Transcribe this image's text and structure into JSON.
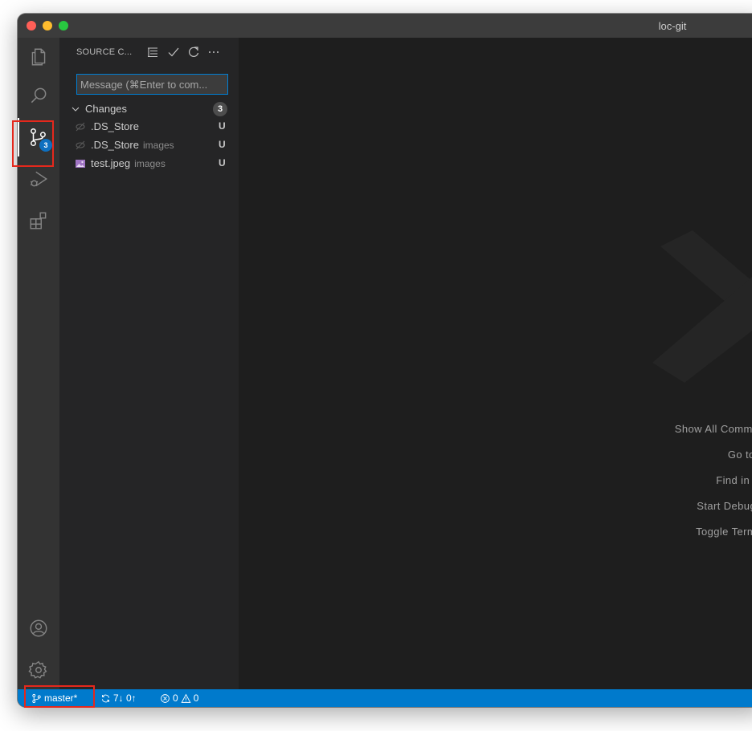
{
  "window": {
    "title": "loc-git"
  },
  "activity_bar": {
    "items": [
      {
        "name": "explorer",
        "icon": "files-icon"
      },
      {
        "name": "search",
        "icon": "search-icon"
      },
      {
        "name": "source-control",
        "icon": "source-control-icon",
        "badge": "3",
        "active": true
      },
      {
        "name": "run-and-debug",
        "icon": "run-debug-icon"
      },
      {
        "name": "extensions",
        "icon": "extensions-icon"
      }
    ],
    "bottom_items": [
      {
        "name": "accounts",
        "icon": "account-icon"
      },
      {
        "name": "manage",
        "icon": "gear-icon"
      }
    ]
  },
  "sidebar": {
    "title": "SOURCE C...",
    "actions": [
      "view-as-tree-icon",
      "commit-check-icon",
      "refresh-icon",
      "more-actions-icon"
    ],
    "message_placeholder": "Message (⌘Enter to com...",
    "changes": {
      "label": "Changes",
      "count": "3",
      "files": [
        {
          "name": ".DS_Store",
          "dir": "",
          "status": "U",
          "icon": "hidden-file-icon"
        },
        {
          "name": ".DS_Store",
          "dir": "images",
          "status": "U",
          "icon": "hidden-file-icon"
        },
        {
          "name": "test.jpeg",
          "dir": "images",
          "status": "U",
          "icon": "image-file-icon"
        }
      ]
    }
  },
  "editor": {
    "shortcuts": [
      "Show All Comman",
      "Go to F",
      "Find in Fil",
      "Start Debuggi",
      "Toggle Termin"
    ]
  },
  "status_bar": {
    "branch": "master*",
    "sync": "7↓ 0↑",
    "errors": "0",
    "warnings": "0"
  },
  "colors": {
    "accent": "#007acc",
    "highlight": "#e5281c",
    "badge": "#0e70c0"
  }
}
